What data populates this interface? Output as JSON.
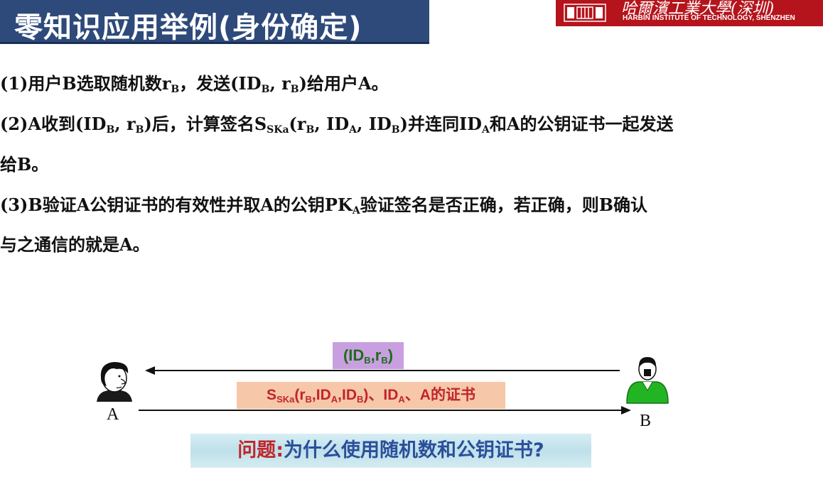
{
  "header": {
    "title": "零知识应用举例(身份确定)"
  },
  "logo": {
    "name_cn": "哈爾濱工業大學(深圳)",
    "name_en": "HARBIN INSTITUTE OF TECHNOLOGY, SHENZHEN",
    "emblem_icon": "hit-emblem-icon"
  },
  "steps": {
    "s1": {
      "a": "(1)用户B选取随机数r",
      "b": "B",
      "c": "，发送(ID",
      "d": "B",
      "e": ", r",
      "f": "B",
      "g": ")给用户A。"
    },
    "s2": {
      "a": "(2)A收到(ID",
      "b": "B",
      "c": ", r",
      "d": "B",
      "e": ")后，计算签名S",
      "f": "SKa",
      "g": "(r",
      "h": "B",
      "i": ", ID",
      "j": "A",
      "k": ", ID",
      "l": "B",
      "m": ")并连同ID",
      "n": "A",
      "o": "和A的公钥证书一起发送"
    },
    "s2b": "给B。",
    "s3": {
      "a": "(3)B验证A公钥证书的有效性并取A的公钥PK",
      "b": "A",
      "c": "验证签名是否正确，若正确，则B确认"
    },
    "s3b": "与之通信的就是A。"
  },
  "diagram": {
    "label_a": "A",
    "label_b": "B",
    "msg_top": {
      "a": "(ID",
      "b": "B",
      "c": ",r",
      "d": "B",
      "e": ")"
    },
    "msg_bottom": {
      "a": "S",
      "b": "SKa",
      "c": "(r",
      "d": "B",
      "e": ",ID",
      "f": "A",
      "g": ",ID",
      "h": "B",
      "i": ")、ID",
      "j": "A",
      "k": "、A的证书"
    },
    "colors": {
      "top_box": "#c9a0df",
      "bottom_box": "#f6c7a8",
      "person_b": "#22b422"
    }
  },
  "question": {
    "prefix": "问题:",
    "text": "为什么使用随机数和公钥证书?"
  }
}
